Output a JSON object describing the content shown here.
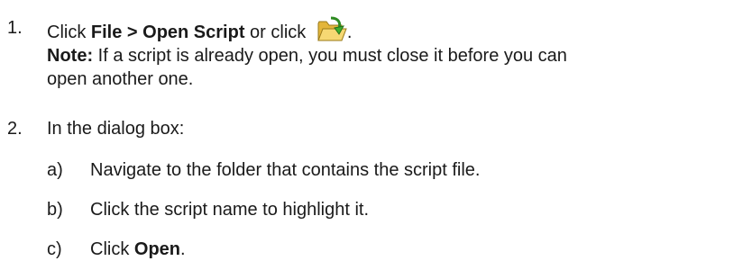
{
  "steps": [
    {
      "number": "1.",
      "prefix": "Click ",
      "menu_path": "File > Open Script",
      "mid": " or click ",
      "icon": "open-folder-icon",
      "suffix": ".",
      "note_label": "Note:",
      "note_line1": " If a script is already open, you must close it before you can",
      "note_line2": "open another one."
    },
    {
      "number": "2.",
      "text": "In the dialog box:",
      "substeps": [
        {
          "letter": "a)",
          "text": "Navigate to the folder that contains the script file."
        },
        {
          "letter": "b)",
          "text": "Click the script name to highlight it."
        },
        {
          "letter": "c)",
          "prefix": "Click ",
          "bold": "Open",
          "suffix": "."
        }
      ]
    }
  ],
  "colors": {
    "text": "#1a1a1a",
    "folder_yellow": "#f2cf57",
    "arrow_green": "#3a9a2a"
  }
}
